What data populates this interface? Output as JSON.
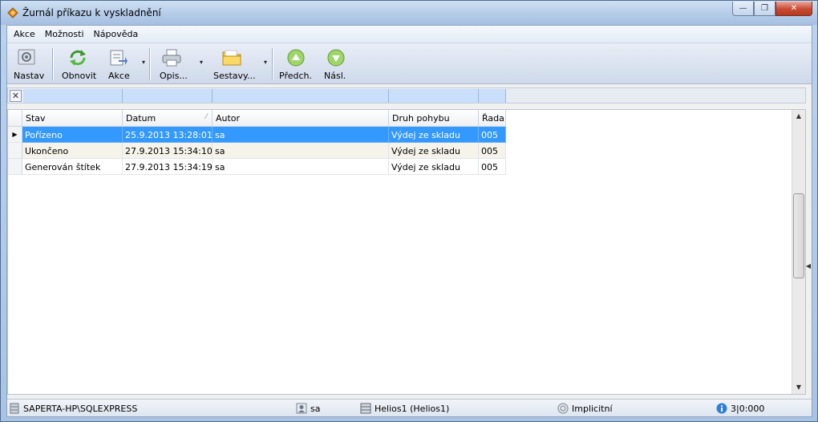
{
  "window": {
    "title": "Žurnál příkazu k vyskladnění",
    "minimize": "—",
    "maximize": "❐",
    "close": "✕"
  },
  "menu": {
    "items": [
      "Akce",
      "Možnosti",
      "Nápověda"
    ]
  },
  "toolbar": {
    "settings_label": "Nastav",
    "refresh_label": "Obnovit",
    "actions_label": "Akce",
    "print_label": "Opis...",
    "reports_label": "Sestavy...",
    "prev_label": "Předch.",
    "next_label": "Násl.",
    "dropdown_glyph": "▾"
  },
  "grid": {
    "columns": [
      "Stav",
      "Datum",
      "Autor",
      "Druh pohybu",
      "Řada"
    ],
    "sort_glyph": "⁄",
    "current_row_glyph": "▶",
    "rows": [
      {
        "stav": "Pořízeno",
        "datum": "25.9.2013 13:28:01",
        "autor": "sa",
        "druh": "Výdej ze skladu",
        "rada": "005"
      },
      {
        "stav": "Ukončeno",
        "datum": "27.9.2013 15:34:10",
        "autor": "sa",
        "druh": "Výdej ze skladu",
        "rada": "005"
      },
      {
        "stav": "Generován štítek",
        "datum": "27.9.2013 15:34:19",
        "autor": "sa",
        "druh": "Výdej ze skladu",
        "rada": "005"
      }
    ]
  },
  "filter": {
    "clear_glyph": "✕"
  },
  "scroll": {
    "up": "▲",
    "down": "▼",
    "splitter": "◀"
  },
  "status": {
    "server": "SAPERTA-HP\\SQLEXPRESS",
    "user": "sa",
    "database": "Helios1 (Helios1)",
    "profile": "Implicitní",
    "info": "3|0:000"
  },
  "colors": {
    "selection": "#3399ff",
    "filter_cell": "#c9dffb",
    "close_button": "#c94a33"
  }
}
